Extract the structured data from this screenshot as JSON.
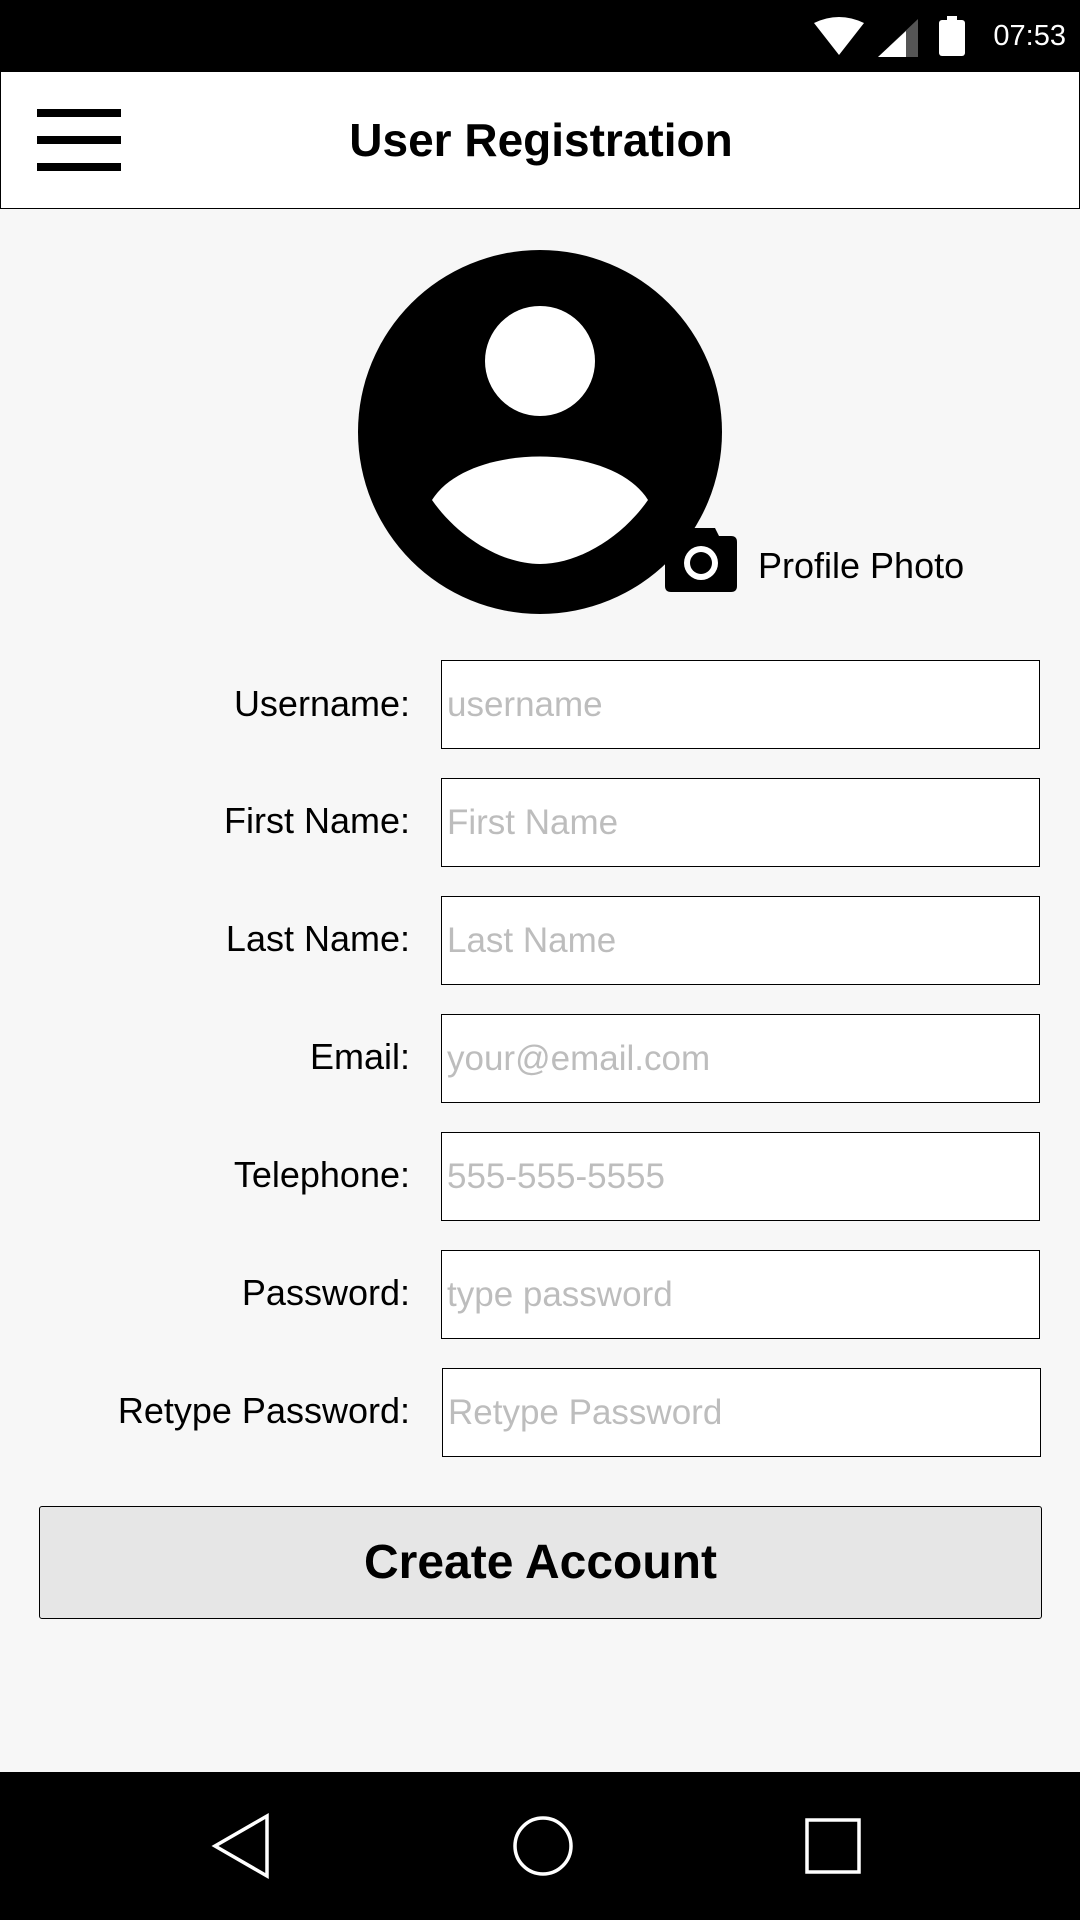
{
  "status_bar": {
    "time": "07:53",
    "icons": [
      "wifi-icon",
      "cell-signal-icon",
      "battery-icon"
    ]
  },
  "app_bar": {
    "title": "User Registration",
    "menu_icon": "hamburger-menu-icon"
  },
  "profile": {
    "avatar_icon": "person-avatar-icon",
    "camera_icon": "camera-icon",
    "label": "Profile Photo"
  },
  "form": {
    "fields": [
      {
        "label": "Username:",
        "placeholder": "username"
      },
      {
        "label": "First Name:",
        "placeholder": "First Name"
      },
      {
        "label": "Last Name:",
        "placeholder": "Last Name"
      },
      {
        "label": "Email:",
        "placeholder": "your@email.com"
      },
      {
        "label": "Telephone:",
        "placeholder": "555-555-5555"
      },
      {
        "label": "Password:",
        "placeholder": "type password"
      },
      {
        "label": "Retype Password:",
        "placeholder": "Retype Password"
      }
    ],
    "submit_label": "Create Account"
  },
  "nav_bar": {
    "icons": [
      "back-icon",
      "home-icon",
      "recents-icon"
    ]
  },
  "colors": {
    "background": "#f7f7f7",
    "system_bars": "#000000",
    "app_bar": "#ffffff",
    "button": "#e6e6e6",
    "placeholder": "#bdbdbd"
  }
}
